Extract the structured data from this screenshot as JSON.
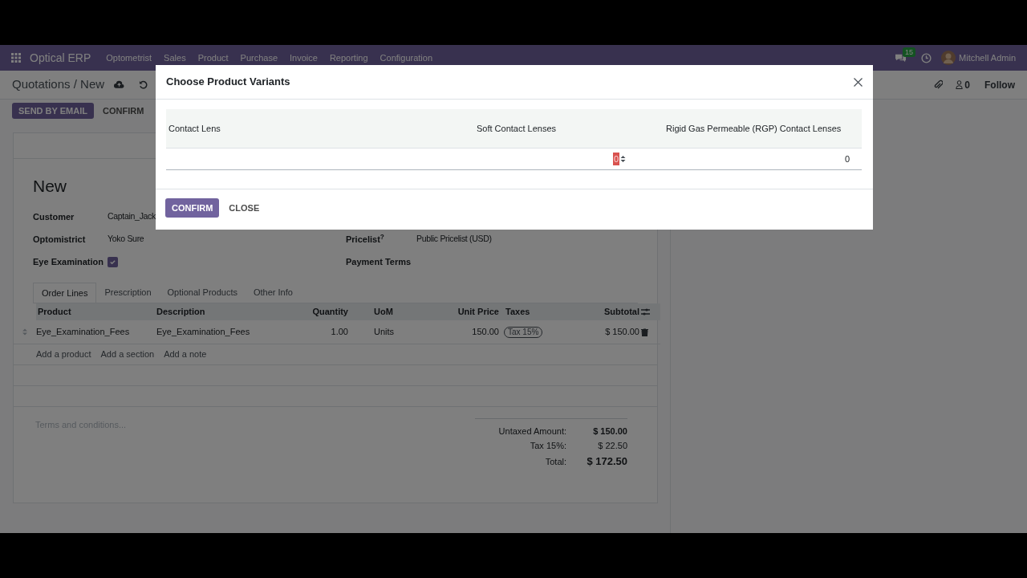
{
  "navbar": {
    "brand": "Optical ERP",
    "menu": [
      "Optometrist",
      "Sales",
      "Product",
      "Purchase",
      "Invoice",
      "Reporting",
      "Configuration"
    ],
    "messages_badge": "15",
    "user": "Mitchell Admin"
  },
  "control_panel": {
    "breadcrumb": "Quotations / New",
    "buttons": [
      {
        "label": "SEND BY EMAIL",
        "kind": "primary"
      },
      {
        "label": "CONFIRM",
        "kind": "secondary"
      }
    ],
    "followers": "0",
    "follow": "Follow"
  },
  "form": {
    "title": "New",
    "left_fields": [
      {
        "label": "Customer",
        "kind": "text",
        "value": "Captain_Jack"
      },
      {
        "label": "Optomistrict",
        "kind": "text",
        "value": "Yoko Sure"
      },
      {
        "label": "Eye Examination",
        "kind": "checkbox",
        "checked": true
      }
    ],
    "right_fields": [
      {
        "label": "Pricelist$^{?}$",
        "kind": "text",
        "value": "Public Pricelist (USD)"
      },
      {
        "label": "Payment Terms",
        "kind": "text"
      }
    ],
    "tabs": [
      {
        "label": "Order Lines",
        "selected": true
      },
      {
        "label": "Prescription",
        "selected": false
      },
      {
        "label": "Optional Products",
        "selected": false
      },
      {
        "label": "Other Info",
        "selected": false
      }
    ],
    "order_lines": {
      "columns": [
        "Product",
        "Description",
        "Quantity",
        "UoM",
        "Unit Price",
        "Taxes",
        "Subtotal"
      ],
      "rows": [
        {
          "product": "Eye_Examination_Fees",
          "description": "Eye_Examination_Fees",
          "quantity": "1.00",
          "uom": "Units",
          "unit_price": "150.00",
          "taxes": "Tax 15%",
          "subtotal": "$ 150.00"
        }
      ],
      "add_links": [
        "Add a product",
        "Add a section",
        "Add a note"
      ]
    },
    "terms_placeholder": "Terms and conditions...",
    "totals": [
      {
        "label": "Untaxed Amount:",
        "value": "$ 150.00",
        "kind": "bold"
      },
      {
        "label": "Tax 15%:",
        "value": "$ 22.50",
        "kind": "plain"
      },
      {
        "label": "Total:",
        "value": "$ 172.50",
        "kind": "grand"
      }
    ]
  },
  "dialog": {
    "title": "Choose Product Variants",
    "columns": [
      "Contact Lens",
      "Soft Contact Lenses",
      "Rigid Gas Permeable (RGP) Contact Lenses"
    ],
    "inputs": [
      {
        "value": "0",
        "text_selected": true
      },
      {
        "value": "0",
        "text_selected": false
      }
    ],
    "buttons": [
      {
        "label": "CONFIRM",
        "kind": "primary"
      },
      {
        "label": "CLOSE",
        "kind": "secondary"
      }
    ]
  }
}
